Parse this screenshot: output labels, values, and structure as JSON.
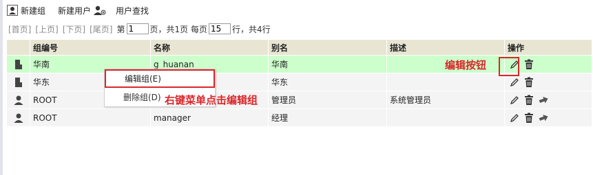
{
  "toolbar": {
    "new_group": "新建组",
    "new_user": "新建用户",
    "find_user": "用户查找"
  },
  "pager": {
    "first": "[首页]",
    "prev": "[上页]",
    "next": "[下页]",
    "last": "[尾页]",
    "page_prefix": "第",
    "page_value": "1",
    "page_suffix": "页，共1页 每页",
    "size_value": "15",
    "size_suffix": "行，共4行"
  },
  "table": {
    "headers": [
      "组编号",
      "名称",
      "别名",
      "描述",
      "操作"
    ],
    "rows": [
      {
        "type": "group",
        "code": "华南",
        "name": "g_huanan",
        "alias": "华南",
        "desc": ""
      },
      {
        "type": "group",
        "code": "华东",
        "name": "",
        "alias": "华东",
        "desc": ""
      },
      {
        "type": "user",
        "code": "ROOT",
        "name": "",
        "alias": "管理员",
        "desc": "系统管理员"
      },
      {
        "type": "user",
        "code": "ROOT",
        "name": "manager",
        "alias": "经理",
        "desc": ""
      }
    ]
  },
  "context_menu": {
    "edit": "编辑组(E)",
    "delete": "删除组(D)"
  },
  "annotations": {
    "edit_button": "编辑按钮",
    "right_click": "右键菜单点击编辑组"
  },
  "colors": {
    "accent_red": "#d9262a",
    "selected_row": "#ccffcc",
    "header_bg": "#e8e6d3"
  }
}
